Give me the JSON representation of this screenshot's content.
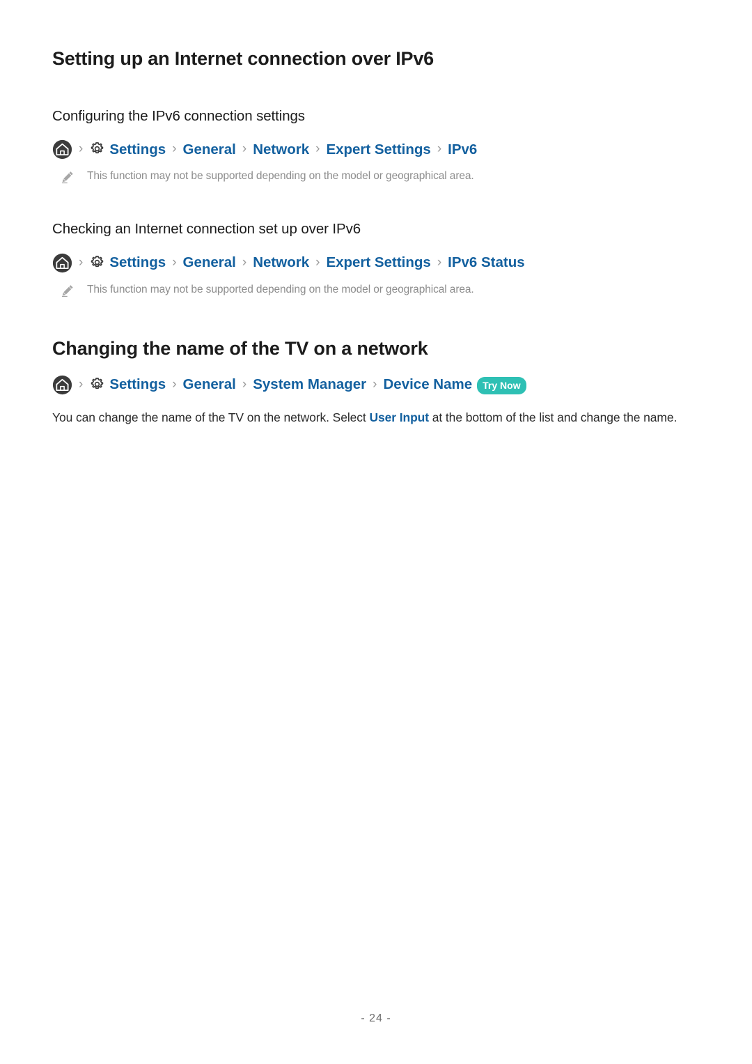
{
  "page": {
    "title": "Setting up an Internet connection over IPv6",
    "footer_label": "- 24 -",
    "accent_blue": "#13609f",
    "badge_teal": "#2ec0b4",
    "note_gray": "#8d8d8d"
  },
  "sections": [
    {
      "heading": "Configuring the IPv6 connection settings",
      "breadcrumb": {
        "home_icon": "home-icon",
        "gear_icon": "gear-icon",
        "separator": "›",
        "items": [
          "Settings",
          "General",
          "Network",
          "Expert Settings",
          "IPv6"
        ]
      },
      "note": {
        "icon": "pencil-icon",
        "text": "This function may not be supported depending on the model or geographical area."
      }
    },
    {
      "heading": "Checking an Internet connection set up over IPv6",
      "breadcrumb": {
        "home_icon": "home-icon",
        "gear_icon": "gear-icon",
        "separator": "›",
        "items": [
          "Settings",
          "General",
          "Network",
          "Expert Settings",
          "IPv6 Status"
        ]
      },
      "note": {
        "icon": "pencil-icon",
        "text": "This function may not be supported depending on the model or geographical area."
      }
    }
  ],
  "section_tv_name": {
    "heading": "Changing the name of the TV on a network",
    "breadcrumb": {
      "home_icon": "home-icon",
      "gear_icon": "gear-icon",
      "separator": "›",
      "items": [
        "Settings",
        "General",
        "System Manager",
        "Device Name"
      ],
      "badge": "Try Now"
    },
    "paragraph": {
      "before_link": "You can change the name of the TV on the network. Select ",
      "link": "User Input",
      "after_link": " at the bottom of the list and change the name."
    }
  }
}
